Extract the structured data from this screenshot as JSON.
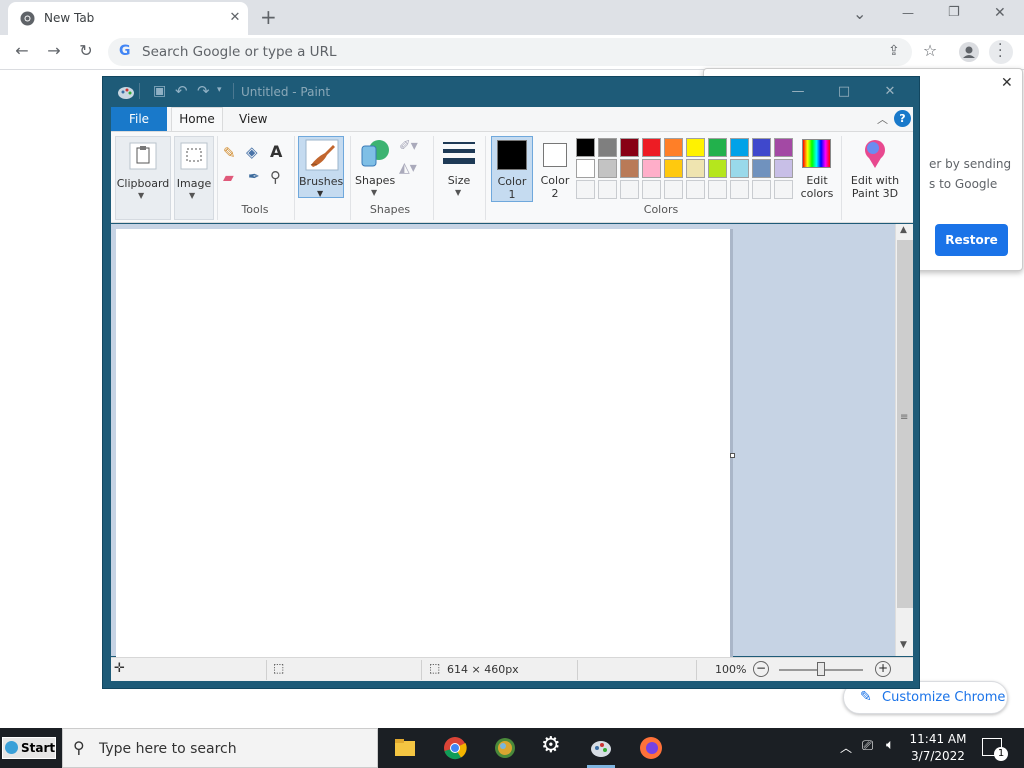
{
  "browser": {
    "tab_title": "New Tab",
    "tab_close": "✕",
    "new_tab": "+",
    "omnibox_placeholder": "Search Google or type a URL",
    "window_controls": {
      "dropdown": "⌄",
      "minimize": "—",
      "restore": "❐",
      "close": "✕"
    }
  },
  "notification": {
    "text_line1": "er by sending",
    "text_line2": "s to Google",
    "restore_label": "Restore",
    "close": "✕"
  },
  "customize_chrome": "Customize Chrome",
  "paint": {
    "title": "Untitled - Paint",
    "tabs": {
      "file": "File",
      "home": "Home",
      "view": "View"
    },
    "groups": {
      "clipboard": "Clipboard",
      "image": "Image",
      "tools": "Tools",
      "brushes": "Brushes",
      "shapes": "Shapes",
      "shapes_group": "Shapes",
      "size": "Size",
      "color1": "Color\n1",
      "color2": "Color\n2",
      "colors": "Colors",
      "edit_colors": "Edit\ncolors",
      "edit_paint3d": "Edit with\nPaint 3D"
    },
    "color1_line1": "Color",
    "color1_line2": "1",
    "color2_line1": "Color",
    "color2_line2": "2",
    "edit_colors_line1": "Edit",
    "edit_colors_line2": "colors",
    "paint3d_line1": "Edit with",
    "paint3d_line2": "Paint 3D",
    "palette_row1": [
      "#000000",
      "#7f7f7f",
      "#880015",
      "#ed1c24",
      "#ff7f27",
      "#fff200",
      "#22b14c",
      "#00a2e8",
      "#3f48cc",
      "#a349a4"
    ],
    "palette_row2": [
      "#ffffff",
      "#c3c3c3",
      "#b97a57",
      "#ffaec9",
      "#ffc90e",
      "#efe4b0",
      "#b5e61d",
      "#99d9ea",
      "#7092be",
      "#c8bfe7"
    ],
    "canvas_size": "614 × 460px",
    "zoom": "100%"
  },
  "taskbar": {
    "start": "Start",
    "search_placeholder": "Type here to search",
    "time": "11:41 AM",
    "date": "3/7/2022",
    "notification_count": "1"
  }
}
